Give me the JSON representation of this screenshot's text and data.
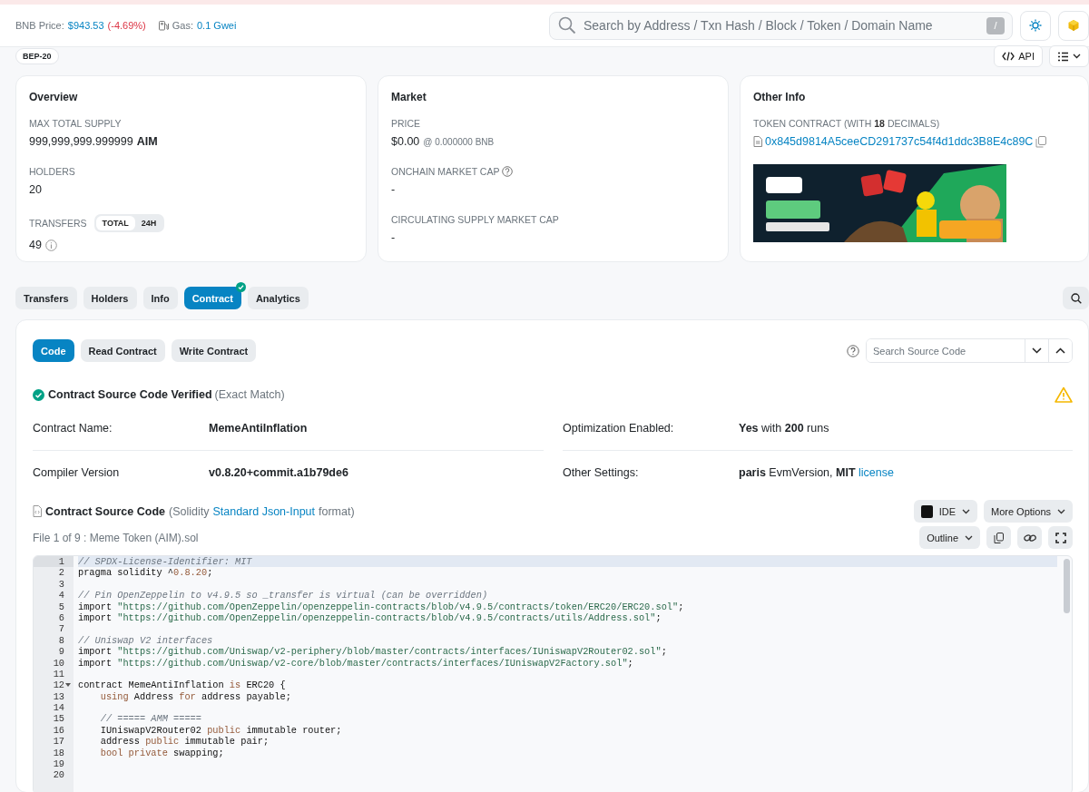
{
  "header": {
    "price_label": "BNB Price:",
    "price_value": "$943.53",
    "price_change": "(-4.69%)",
    "gas_label": "Gas:",
    "gas_value": "0.1 Gwei",
    "search_placeholder": "Search by Address / Txn Hash / Block / Token / Domain Name",
    "search_shortcut": "/"
  },
  "token_badge": "BEP-20",
  "api_button": "API",
  "overview": {
    "title": "Overview",
    "supply_label": "MAX TOTAL SUPPLY",
    "supply_value": "999,999,999.999999",
    "supply_symbol": "AIM",
    "holders_label": "HOLDERS",
    "holders_value": "20",
    "transfers_label": "TRANSFERS",
    "transfer_toggle": [
      {
        "label": "TOTAL",
        "selected": true
      },
      {
        "label": "24H",
        "selected": false
      }
    ],
    "transfers_value": "49"
  },
  "market": {
    "title": "Market",
    "price_label": "PRICE",
    "price_value": "$0.00",
    "price_bnb": "@ 0.000000 BNB",
    "onchain_cap_label": "ONCHAIN MARKET CAP",
    "onchain_cap_value": "-",
    "circulating_cap_label": "CIRCULATING SUPPLY MARKET CAP",
    "circulating_cap_value": "-"
  },
  "other_info": {
    "title": "Other Info",
    "contract_label": "TOKEN CONTRACT (WITH **18** DECIMALS)",
    "contract_address": "0x845d9814A5ceeCD291737c54f4d1ddc3B8E4c89C"
  },
  "tabs": [
    {
      "label": "Transfers",
      "selected": false,
      "verified_badge": false
    },
    {
      "label": "Holders",
      "selected": false,
      "verified_badge": false
    },
    {
      "label": "Info",
      "selected": false,
      "verified_badge": false
    },
    {
      "label": "Contract",
      "selected": true,
      "verified_badge": true
    },
    {
      "label": "Analytics",
      "selected": false,
      "verified_badge": false
    }
  ],
  "contract": {
    "subtabs": [
      {
        "label": "Code",
        "selected": true
      },
      {
        "label": "Read Contract",
        "selected": false
      },
      {
        "label": "Write Contract",
        "selected": false
      }
    ],
    "search_placeholder": "Search Source Code",
    "verified_title": "Contract Source Code Verified",
    "verified_note": "(Exact Match)",
    "details": [
      {
        "label": "Contract Name:",
        "value": "MemeAntiInflation",
        "bold": true
      },
      {
        "label": "Optimization Enabled:",
        "value": "**Yes** with **200** runs",
        "bold": false
      },
      {
        "label": "Compiler Version",
        "value": "v0.8.20+commit.a1b79de6",
        "bold": true
      },
      {
        "label": "Other Settings:",
        "value": "**paris** EvmVersion, **MIT**",
        "link": "license",
        "bold": false
      }
    ],
    "source_title": "Contract Source Code",
    "source_note_before": "(Solidity",
    "source_link": "Standard Json-Input",
    "source_note_after": "format)",
    "ide_button": "IDE",
    "more_button": "More Options",
    "file_label": "File 1 of 9 : Meme Token (AIM).sol",
    "outline_button": "Outline",
    "code_lines": [
      {
        "n": "1",
        "active": true,
        "fold": false,
        "segs": [
          {
            "kind": "comment",
            "text": "// SPDX-License-Identifier: MIT"
          }
        ]
      },
      {
        "n": "2",
        "active": false,
        "fold": false,
        "segs": [
          {
            "kind": "plain",
            "text": "pragma solidity ^"
          },
          {
            "kind": "number",
            "text": "0.8.20"
          },
          {
            "kind": "plain",
            "text": ";"
          }
        ]
      },
      {
        "n": "3",
        "active": false,
        "fold": false
      },
      {
        "n": "4",
        "active": false,
        "fold": false,
        "segs": [
          {
            "kind": "comment",
            "text": "// Pin OpenZeppelin to v4.9.5 so _transfer is virtual (can be overridden)"
          }
        ]
      },
      {
        "n": "5",
        "active": false,
        "fold": false,
        "segs": [
          {
            "kind": "plain",
            "text": "import "
          },
          {
            "kind": "string",
            "text": "\"https://github.com/OpenZeppelin/openzeppelin-contracts/blob/v4.9.5/contracts/token/ERC20/ERC20.sol\""
          },
          {
            "kind": "plain",
            "text": ";"
          }
        ]
      },
      {
        "n": "6",
        "active": false,
        "fold": false,
        "segs": [
          {
            "kind": "plain",
            "text": "import "
          },
          {
            "kind": "string",
            "text": "\"https://github.com/OpenZeppelin/openzeppelin-contracts/blob/v4.9.5/contracts/utils/Address.sol\""
          },
          {
            "kind": "plain",
            "text": ";"
          }
        ]
      },
      {
        "n": "7",
        "active": false,
        "fold": false
      },
      {
        "n": "8",
        "active": false,
        "fold": false,
        "segs": [
          {
            "kind": "comment",
            "text": "// Uniswap V2 interfaces"
          }
        ]
      },
      {
        "n": "9",
        "active": false,
        "fold": false,
        "segs": [
          {
            "kind": "plain",
            "text": "import "
          },
          {
            "kind": "string",
            "text": "\"https://github.com/Uniswap/v2-periphery/blob/master/contracts/interfaces/IUniswapV2Router02.sol\""
          },
          {
            "kind": "plain",
            "text": ";"
          }
        ]
      },
      {
        "n": "10",
        "active": false,
        "fold": false,
        "segs": [
          {
            "kind": "plain",
            "text": "import "
          },
          {
            "kind": "string",
            "text": "\"https://github.com/Uniswap/v2-core/blob/master/contracts/interfaces/IUniswapV2Factory.sol\""
          },
          {
            "kind": "plain",
            "text": ";"
          }
        ]
      },
      {
        "n": "11",
        "active": false,
        "fold": false
      },
      {
        "n": "12",
        "active": false,
        "fold": true,
        "segs": [
          {
            "kind": "plain",
            "text": "contract MemeAntiInflation "
          },
          {
            "kind": "keyword",
            "text": "is"
          },
          {
            "kind": "plain",
            "text": " ERC20 {"
          }
        ]
      },
      {
        "n": "13",
        "active": false,
        "fold": false,
        "segs": [
          {
            "kind": "keyword",
            "text": "    using"
          },
          {
            "kind": "plain",
            "text": " Address "
          },
          {
            "kind": "keyword",
            "text": "for"
          },
          {
            "kind": "plain",
            "text": " address payable;"
          }
        ]
      },
      {
        "n": "14",
        "active": false,
        "fold": false
      },
      {
        "n": "15",
        "active": false,
        "fold": false,
        "segs": [
          {
            "kind": "comment",
            "text": "    // ===== AMM ====="
          }
        ]
      },
      {
        "n": "16",
        "active": false,
        "fold": false,
        "segs": [
          {
            "kind": "plain",
            "text": "    IUniswapV2Router02 "
          },
          {
            "kind": "keyword",
            "text": "public"
          },
          {
            "kind": "plain",
            "text": " immutable router;"
          }
        ]
      },
      {
        "n": "17",
        "active": false,
        "fold": false,
        "segs": [
          {
            "kind": "plain",
            "text": "    address "
          },
          {
            "kind": "keyword",
            "text": "public"
          },
          {
            "kind": "plain",
            "text": " immutable pair;"
          }
        ]
      },
      {
        "n": "18",
        "active": false,
        "fold": false,
        "segs": [
          {
            "kind": "keyword",
            "text": "    bool"
          },
          {
            "kind": "keyword",
            "text": " private"
          },
          {
            "kind": "plain",
            "text": " swapping;"
          }
        ]
      },
      {
        "n": "19",
        "active": false,
        "fold": false
      },
      {
        "n": "20",
        "active": false,
        "fold": false
      }
    ]
  }
}
